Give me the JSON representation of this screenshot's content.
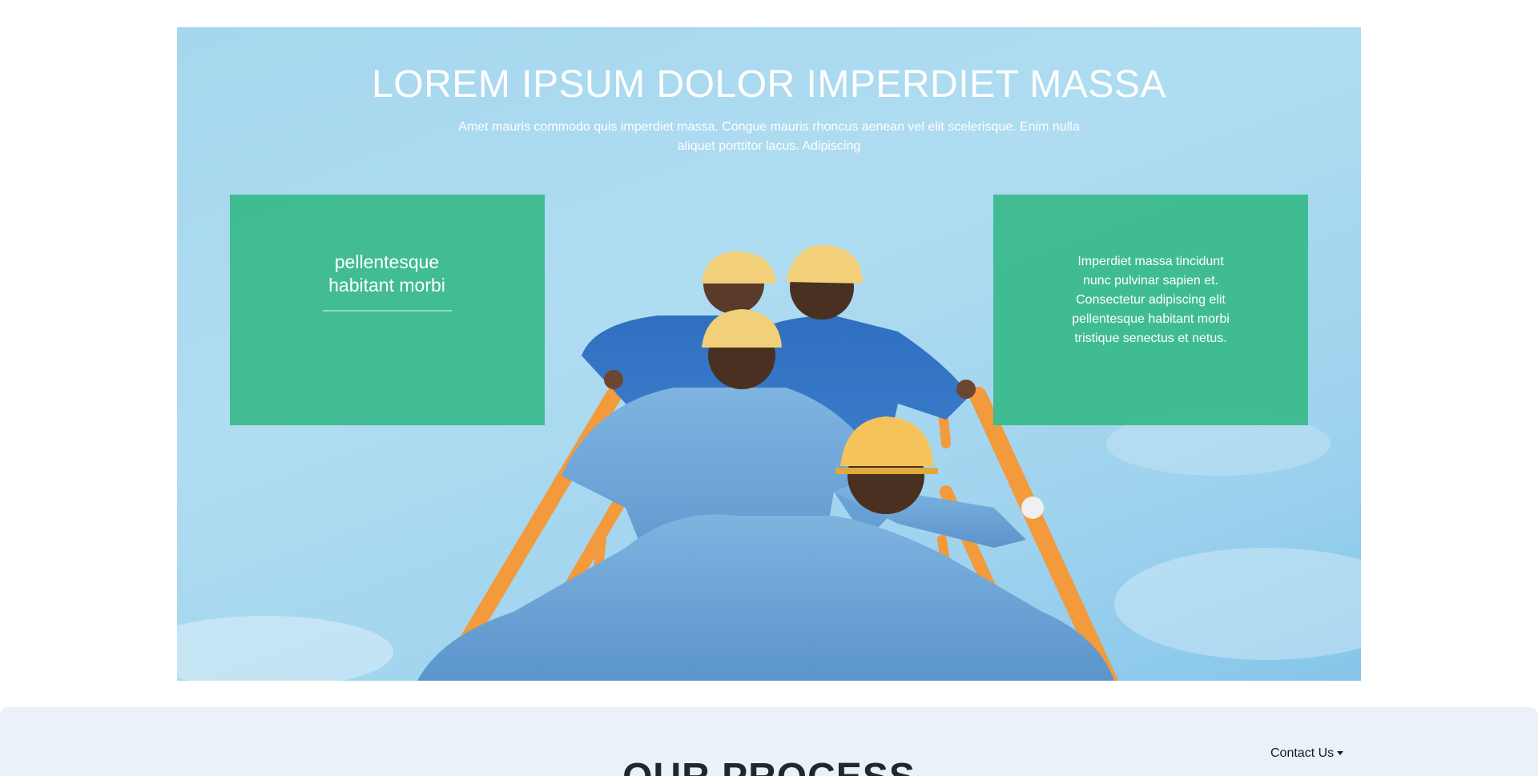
{
  "hero": {
    "title": "LOREM IPSUM DOLOR IMPERDIET MASSA",
    "subtitle": "Amet mauris commodo quis imperdiet massa. Congue mauris rhoncus aenean vel elit scelerisque. Enim nulla aliquet porttitor lacus. Adipiscing",
    "image_icon": "construction-workers-climbing-photo"
  },
  "cards": {
    "left": {
      "heading": "pellentesque habitant morbi"
    },
    "right": {
      "text": "Imperdiet massa tincidunt nunc pulvinar sapien et. Consectetur adipiscing elit pellentesque habitant morbi tristique senectus et netus."
    }
  },
  "process": {
    "title": "OUR PROCESS"
  },
  "nav": {
    "contact_label": "Contact Us"
  },
  "colors": {
    "card_green": "#3dbb8f",
    "sky_blue": "#a6d7ee",
    "process_bg": "#eaf1f9"
  }
}
